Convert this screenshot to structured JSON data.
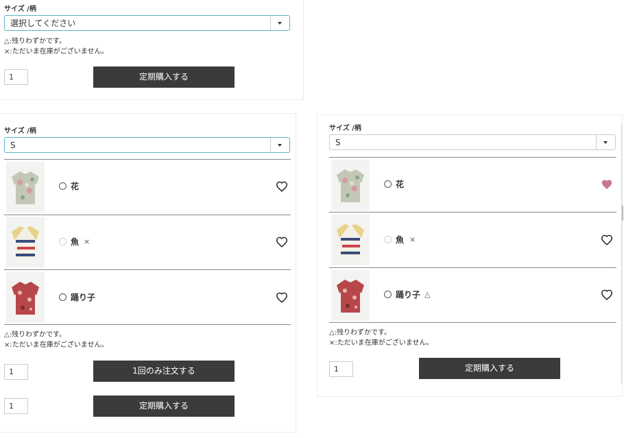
{
  "panel1": {
    "label": "サイズ /柄",
    "select_value": "選択してください",
    "note1": "△:残りわずかです。",
    "note2": "×:ただいま在庫がございません。",
    "qty": "1",
    "button": "定期購入する"
  },
  "panel2": {
    "label": "サイズ /柄",
    "select_value": "S",
    "items": [
      {
        "name": "花",
        "stock": ""
      },
      {
        "name": "魚",
        "stock": "×"
      },
      {
        "name": "踊り子",
        "stock": ""
      }
    ],
    "note1": "△:残りわずかです。",
    "note2": "×:ただいま在庫がございません。",
    "qty1": "1",
    "button1": "1回のみ注文する",
    "qty2": "1",
    "button2": "定期購入する"
  },
  "panel3": {
    "label": "サイズ /柄",
    "select_value": "S",
    "items": [
      {
        "name": "花",
        "stock": "",
        "favorited": true
      },
      {
        "name": "魚",
        "stock": "×",
        "favorited": false
      },
      {
        "name": "踊り子",
        "stock": "△",
        "favorited": false
      }
    ],
    "note1": "△:残りわずかです。",
    "note2": "×:ただいま在庫がございません。",
    "qty": "1",
    "button": "定期購入する"
  },
  "colors": {
    "button_bg": "#3b3b3b",
    "focus_border": "#5bb0c9",
    "heart_active": "#c9788e",
    "shirt_flower": "#b8c0a8",
    "shirt_fish": "#e8d28a",
    "shirt_dancer": "#b8474a"
  },
  "icons": [
    "chevron-down-icon",
    "radio-icon",
    "heart-outline-icon",
    "heart-filled-icon",
    "shirt-image"
  ]
}
